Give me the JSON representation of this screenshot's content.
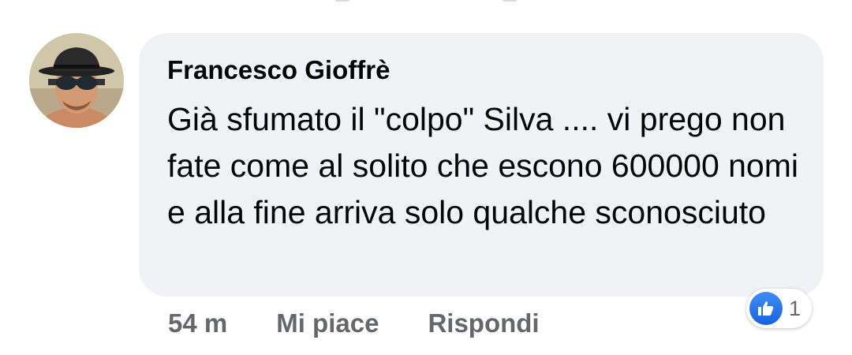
{
  "comment": {
    "author": "Francesco Gioffrè",
    "text": "Già sfumato il \"colpo\" Silva .... vi prego non fate come al solito che escono 600000 nomi e alla fine arriva solo qualche sconosciuto",
    "time": "54 m",
    "like_label": "Mi piace",
    "reply_label": "Rispondi",
    "reaction_count": "1",
    "reaction_icon": "thumbs-up-icon"
  },
  "colors": {
    "bubble": "#f0f2f5",
    "text": "#050505",
    "secondary": "#65676b",
    "like_blue": "#1877f2"
  }
}
